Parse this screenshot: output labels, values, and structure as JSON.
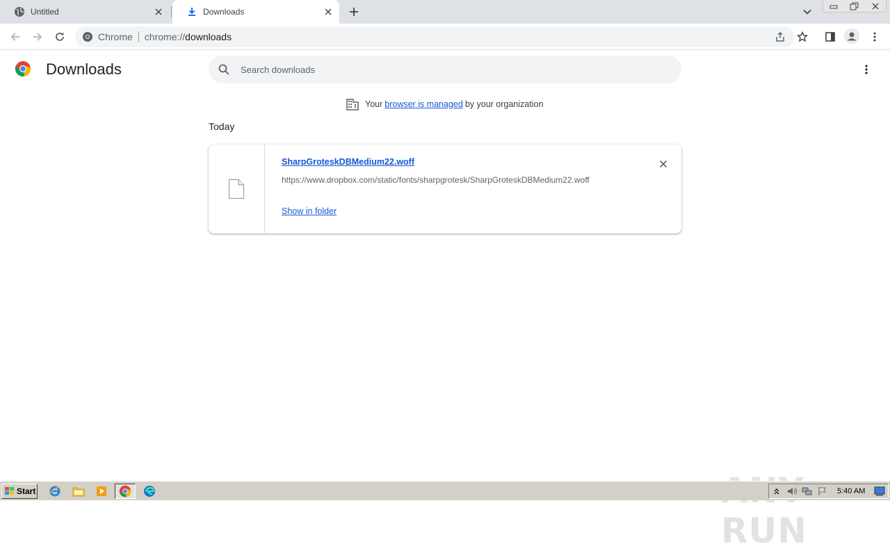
{
  "tabs": [
    {
      "title": "Untitled",
      "icon": "globe-icon",
      "active": false
    },
    {
      "title": "Downloads",
      "icon": "download-icon",
      "active": true
    }
  ],
  "omnibox": {
    "chip": "Chrome",
    "url_scheme": "chrome://",
    "url_host": "downloads"
  },
  "page": {
    "title": "Downloads",
    "search_placeholder": "Search downloads",
    "managed": {
      "prefix": "Your",
      "link": "browser is managed",
      "suffix": "by your organization"
    },
    "section_date": "Today",
    "download": {
      "file_name": "SharpGroteskDBMedium22.woff",
      "url": "https://www.dropbox.com/static/fonts/sharpgrotesk/SharpGroteskDBMedium22.woff",
      "action_label": "Show in folder"
    }
  },
  "taskbar": {
    "start_label": "Start",
    "clock": "5:40 AM",
    "pinned": [
      "internet-explorer-icon",
      "file-explorer-icon",
      "media-player-icon",
      "chrome-icon",
      "edge-icon"
    ]
  },
  "watermark": "ANY RUN",
  "colors": {
    "link": "#1558d6",
    "tabstrip_bg": "#dee1e6",
    "omnibox_bg": "#f1f3f4",
    "taskbar_bg": "#d4d0c8"
  }
}
